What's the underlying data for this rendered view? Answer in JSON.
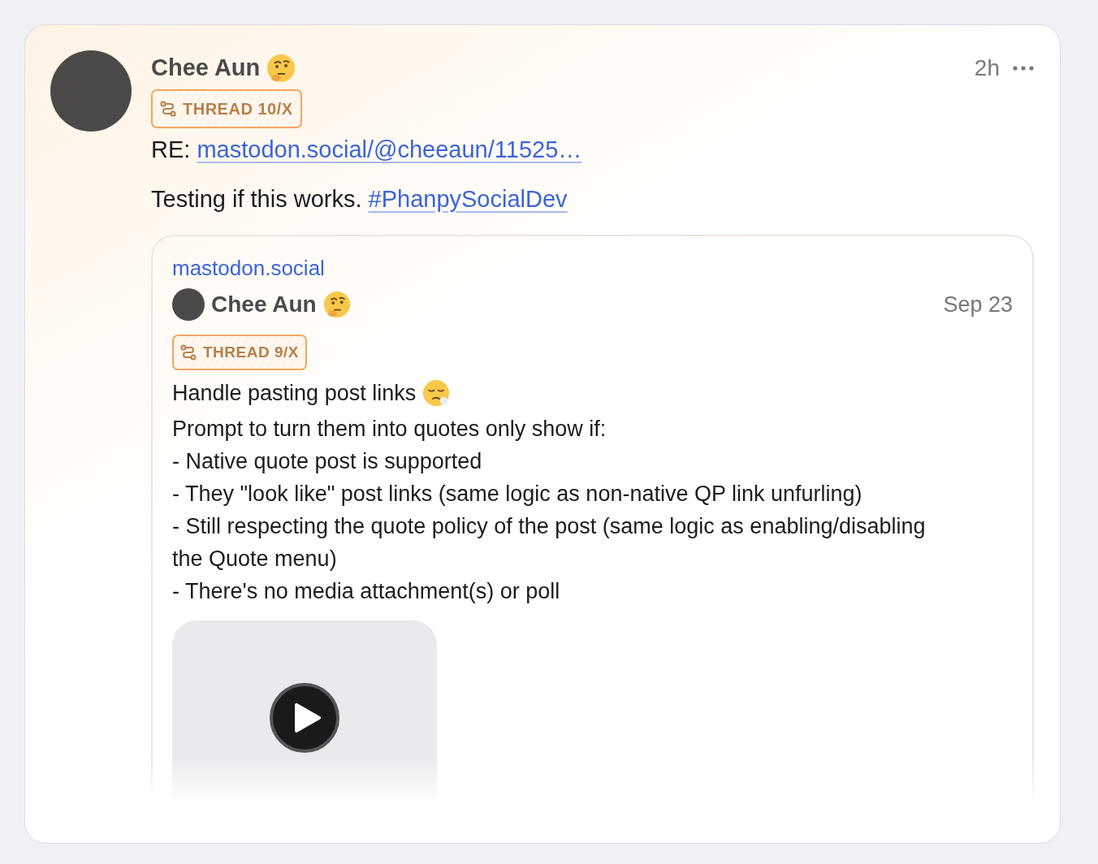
{
  "post": {
    "author": "Chee Aun",
    "time": "2h",
    "thread": "THREAD 10/X",
    "body": [
      {
        "parts": [
          {
            "kind": "text",
            "text": "RE: "
          },
          {
            "kind": "link",
            "text": "mastodon.social/@cheeaun/11525…"
          }
        ]
      },
      {
        "parts": [
          {
            "kind": "text",
            "text": "Testing if this works. "
          },
          {
            "kind": "hashtag",
            "text": "#PhanpySocialDev"
          }
        ]
      }
    ]
  },
  "quote": {
    "domain": "mastodon.social",
    "author": "Chee Aun",
    "time": "Sep 23",
    "thread": "THREAD 9/X",
    "title": "Handle pasting post links",
    "lines": [
      "Prompt to turn them into quotes only show if:",
      "- Native quote post is supported",
      "- They \"look like\" post links (same logic as non-native QP link unfurling)",
      "- Still respecting the quote policy of the post (same logic as enabling/disabling the Quote menu)",
      "- There's no media attachment(s) or poll"
    ]
  }
}
